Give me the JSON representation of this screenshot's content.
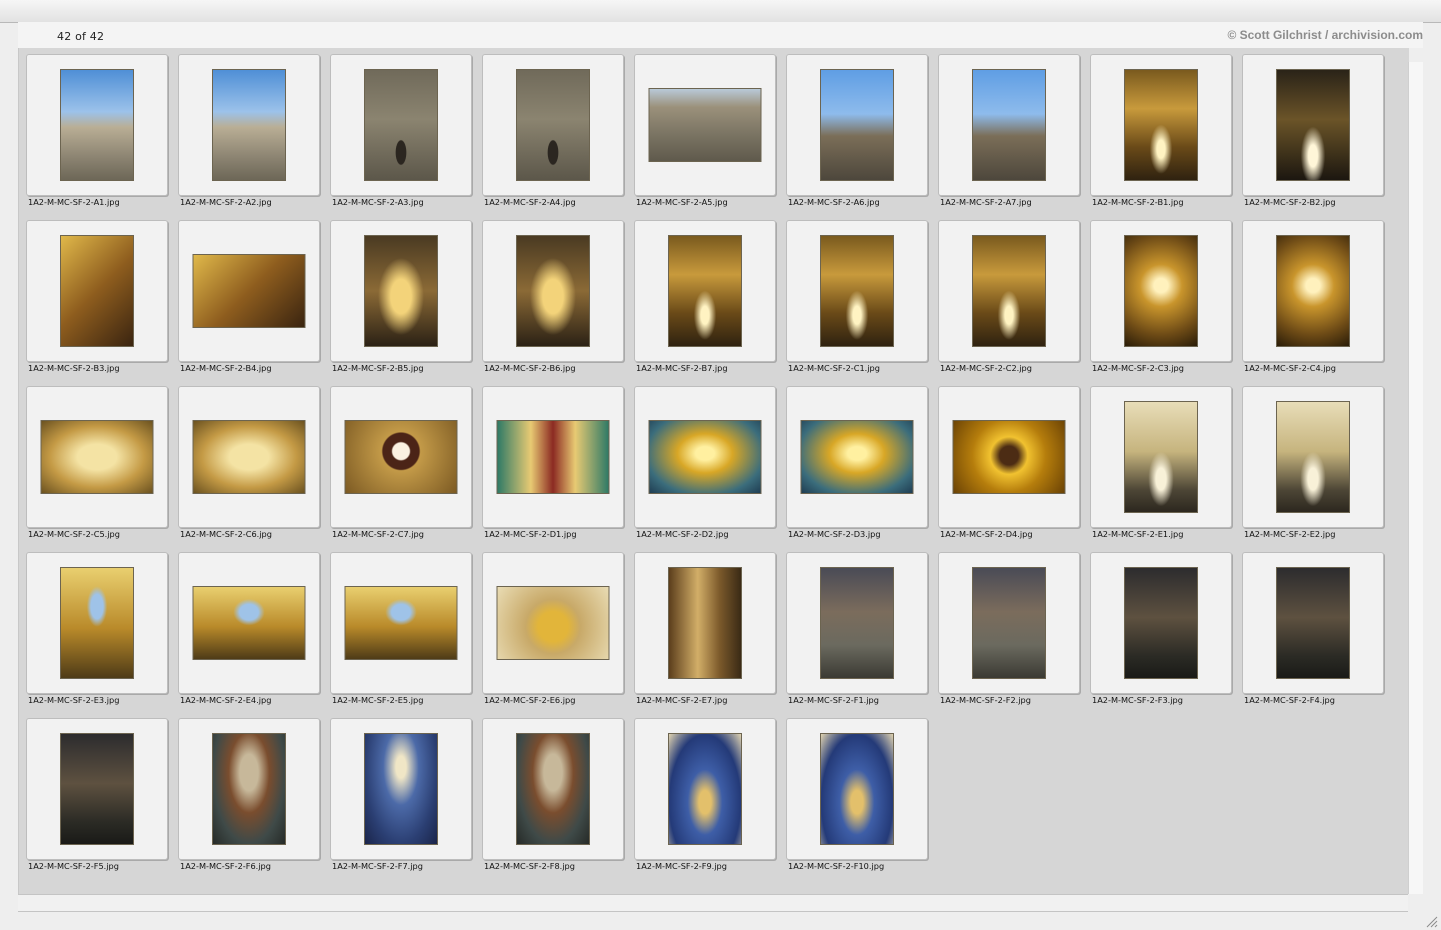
{
  "viewer": {
    "counter": "42 of 42",
    "credit": "© Scott Gilchrist / archivision.com"
  },
  "thumbnails": [
    {
      "name": "1A2-M-MC-SF-2-A1.jpg",
      "orient": "portrait",
      "tone": "t-sky"
    },
    {
      "name": "1A2-M-MC-SF-2-A2.jpg",
      "orient": "portrait",
      "tone": "t-sky"
    },
    {
      "name": "1A2-M-MC-SF-2-A3.jpg",
      "orient": "portrait",
      "tone": "t-facade"
    },
    {
      "name": "1A2-M-MC-SF-2-A4.jpg",
      "orient": "portrait",
      "tone": "t-facade"
    },
    {
      "name": "1A2-M-MC-SF-2-A5.jpg",
      "orient": "landscape",
      "tone": "t-stone"
    },
    {
      "name": "1A2-M-MC-SF-2-A6.jpg",
      "orient": "portrait",
      "tone": "t-tower"
    },
    {
      "name": "1A2-M-MC-SF-2-A7.jpg",
      "orient": "portrait",
      "tone": "t-tower"
    },
    {
      "name": "1A2-M-MC-SF-2-B1.jpg",
      "orient": "portrait",
      "tone": "t-nave"
    },
    {
      "name": "1A2-M-MC-SF-2-B2.jpg",
      "orient": "portrait",
      "tone": "t-navedark"
    },
    {
      "name": "1A2-M-MC-SF-2-B3.jpg",
      "orient": "portrait",
      "tone": "t-warm"
    },
    {
      "name": "1A2-M-MC-SF-2-B4.jpg",
      "orient": "landscape",
      "tone": "t-warm"
    },
    {
      "name": "1A2-M-MC-SF-2-B5.jpg",
      "orient": "portrait",
      "tone": "t-altar"
    },
    {
      "name": "1A2-M-MC-SF-2-B6.jpg",
      "orient": "portrait",
      "tone": "t-altar"
    },
    {
      "name": "1A2-M-MC-SF-2-B7.jpg",
      "orient": "portrait",
      "tone": "t-nave"
    },
    {
      "name": "1A2-M-MC-SF-2-C1.jpg",
      "orient": "portrait",
      "tone": "t-nave"
    },
    {
      "name": "1A2-M-MC-SF-2-C2.jpg",
      "orient": "portrait",
      "tone": "t-nave"
    },
    {
      "name": "1A2-M-MC-SF-2-C3.jpg",
      "orient": "portrait",
      "tone": "t-dome"
    },
    {
      "name": "1A2-M-MC-SF-2-C4.jpg",
      "orient": "portrait",
      "tone": "t-dome"
    },
    {
      "name": "1A2-M-MC-SF-2-C5.jpg",
      "orient": "landscape",
      "tone": "t-ceiling"
    },
    {
      "name": "1A2-M-MC-SF-2-C6.jpg",
      "orient": "landscape",
      "tone": "t-ceiling"
    },
    {
      "name": "1A2-M-MC-SF-2-C7.jpg",
      "orient": "landscape",
      "tone": "t-oct"
    },
    {
      "name": "1A2-M-MC-SF-2-D1.jpg",
      "orient": "landscape",
      "tone": "t-retablo"
    },
    {
      "name": "1A2-M-MC-SF-2-D2.jpg",
      "orient": "landscape",
      "tone": "t-gold"
    },
    {
      "name": "1A2-M-MC-SF-2-D3.jpg",
      "orient": "landscape",
      "tone": "t-gold"
    },
    {
      "name": "1A2-M-MC-SF-2-D4.jpg",
      "orient": "landscape",
      "tone": "t-rays"
    },
    {
      "name": "1A2-M-MC-SF-2-E1.jpg",
      "orient": "portrait",
      "tone": "t-corridor"
    },
    {
      "name": "1A2-M-MC-SF-2-E2.jpg",
      "orient": "portrait",
      "tone": "t-corridor"
    },
    {
      "name": "1A2-M-MC-SF-2-E3.jpg",
      "orient": "portrait",
      "tone": "t-crucifix"
    },
    {
      "name": "1A2-M-MC-SF-2-E4.jpg",
      "orient": "landscape",
      "tone": "t-crucifix"
    },
    {
      "name": "1A2-M-MC-SF-2-E5.jpg",
      "orient": "landscape",
      "tone": "t-crucifix"
    },
    {
      "name": "1A2-M-MC-SF-2-E6.jpg",
      "orient": "landscape",
      "tone": "t-ornate"
    },
    {
      "name": "1A2-M-MC-SF-2-E7.jpg",
      "orient": "portrait",
      "tone": "t-font"
    },
    {
      "name": "1A2-M-MC-SF-2-F1.jpg",
      "orient": "portrait",
      "tone": "t-floor"
    },
    {
      "name": "1A2-M-MC-SF-2-F2.jpg",
      "orient": "portrait",
      "tone": "t-floor"
    },
    {
      "name": "1A2-M-MC-SF-2-F3.jpg",
      "orient": "portrait",
      "tone": "t-dark"
    },
    {
      "name": "1A2-M-MC-SF-2-F4.jpg",
      "orient": "portrait",
      "tone": "t-dark"
    },
    {
      "name": "1A2-M-MC-SF-2-F5.jpg",
      "orient": "portrait",
      "tone": "t-dark"
    },
    {
      "name": "1A2-M-MC-SF-2-F6.jpg",
      "orient": "portrait",
      "tone": "t-mural"
    },
    {
      "name": "1A2-M-MC-SF-2-F7.jpg",
      "orient": "portrait",
      "tone": "t-blue"
    },
    {
      "name": "1A2-M-MC-SF-2-F8.jpg",
      "orient": "portrait",
      "tone": "t-mural"
    },
    {
      "name": "1A2-M-MC-SF-2-F9.jpg",
      "orient": "portrait",
      "tone": "t-bluealtar"
    },
    {
      "name": "1A2-M-MC-SF-2-F10.jpg",
      "orient": "portrait",
      "tone": "t-bluealtar"
    }
  ]
}
